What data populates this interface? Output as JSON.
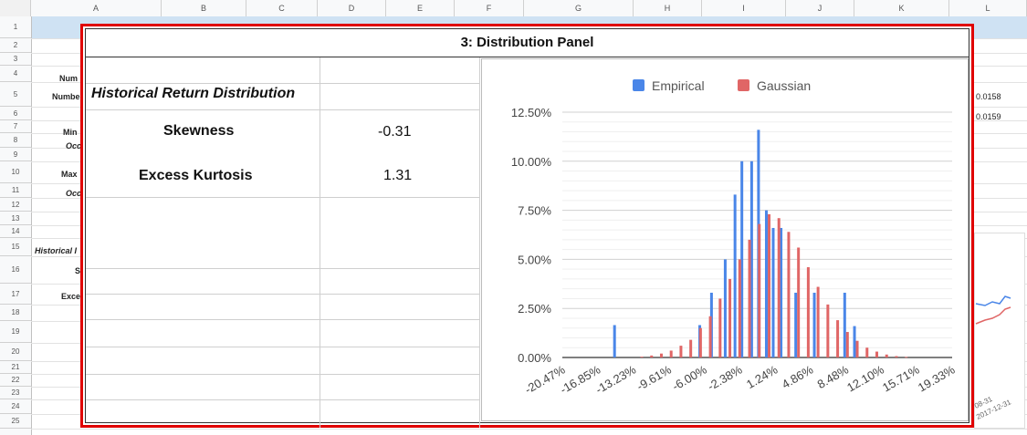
{
  "columns": [
    "A",
    "B",
    "C",
    "D",
    "E",
    "F",
    "G",
    "H",
    "I",
    "J",
    "K",
    "L"
  ],
  "rows": [
    "1",
    "2",
    "3",
    "4",
    "5",
    "6",
    "7",
    "8",
    "9",
    "10",
    "11",
    "12",
    "13",
    "14",
    "15",
    "16",
    "17",
    "18",
    "19",
    "20",
    "21",
    "22",
    "23",
    "24",
    "25"
  ],
  "background": {
    "left_labels": [
      "Num",
      "Numbe",
      "Min",
      "Occ",
      "Max",
      "Occ",
      "Historical I",
      "S",
      "Exce"
    ],
    "right_values": [
      "0.0158",
      "0.0159"
    ],
    "right_dates": [
      "08-31",
      "2017-12-31"
    ]
  },
  "panel": {
    "title": "3: Distribution Panel",
    "section_title": "Historical Return Distribution",
    "stats": [
      {
        "label": "Skewness",
        "value": "-0.31"
      },
      {
        "label": "Excess Kurtosis",
        "value": "1.31"
      }
    ]
  },
  "chart_data": {
    "type": "bar",
    "legend_position": "top",
    "grid": true,
    "colors": {
      "Empirical": "#4a86e8",
      "Gaussian": "#e06666"
    },
    "y_ticks": [
      "0.00%",
      "2.50%",
      "5.00%",
      "7.50%",
      "10.00%",
      "12.50%"
    ],
    "ylim": [
      0,
      0.125
    ],
    "x_tick_labels": [
      "-20.47%",
      "-16.85%",
      "-13.23%",
      "-9.61%",
      "-6.00%",
      "-2.38%",
      "1.24%",
      "4.86%",
      "8.48%",
      "12.10%",
      "15.71%",
      "19.33%"
    ],
    "xlim": [
      -0.2047,
      0.1933
    ],
    "series": [
      {
        "name": "Empirical",
        "points": [
          {
            "x": -0.15,
            "y": 0.0165
          },
          {
            "x": -0.063,
            "y": 0.0165
          },
          {
            "x": -0.051,
            "y": 0.033
          },
          {
            "x": -0.037,
            "y": 0.05
          },
          {
            "x": -0.027,
            "y": 0.083
          },
          {
            "x": -0.02,
            "y": 0.1
          },
          {
            "x": -0.01,
            "y": 0.1
          },
          {
            "x": -0.003,
            "y": 0.116
          },
          {
            "x": 0.005,
            "y": 0.075
          },
          {
            "x": 0.012,
            "y": 0.066
          },
          {
            "x": 0.02,
            "y": 0.066
          },
          {
            "x": 0.035,
            "y": 0.033
          },
          {
            "x": 0.054,
            "y": 0.033
          },
          {
            "x": 0.085,
            "y": 0.033
          },
          {
            "x": 0.095,
            "y": 0.016
          }
        ]
      },
      {
        "name": "Gaussian",
        "points": [
          {
            "x": -0.125,
            "y": 0.0004
          },
          {
            "x": -0.115,
            "y": 0.001
          },
          {
            "x": -0.105,
            "y": 0.002
          },
          {
            "x": -0.095,
            "y": 0.0035
          },
          {
            "x": -0.085,
            "y": 0.006
          },
          {
            "x": -0.075,
            "y": 0.009
          },
          {
            "x": -0.065,
            "y": 0.015
          },
          {
            "x": -0.055,
            "y": 0.021
          },
          {
            "x": -0.045,
            "y": 0.03
          },
          {
            "x": -0.035,
            "y": 0.04
          },
          {
            "x": -0.025,
            "y": 0.05
          },
          {
            "x": -0.015,
            "y": 0.06
          },
          {
            "x": -0.005,
            "y": 0.068
          },
          {
            "x": 0.005,
            "y": 0.073
          },
          {
            "x": 0.015,
            "y": 0.071
          },
          {
            "x": 0.025,
            "y": 0.064
          },
          {
            "x": 0.035,
            "y": 0.056
          },
          {
            "x": 0.045,
            "y": 0.046
          },
          {
            "x": 0.055,
            "y": 0.036
          },
          {
            "x": 0.065,
            "y": 0.027
          },
          {
            "x": 0.075,
            "y": 0.019
          },
          {
            "x": 0.085,
            "y": 0.013
          },
          {
            "x": 0.095,
            "y": 0.0085
          },
          {
            "x": 0.105,
            "y": 0.005
          },
          {
            "x": 0.115,
            "y": 0.003
          },
          {
            "x": 0.125,
            "y": 0.0015
          },
          {
            "x": 0.135,
            "y": 0.0007
          },
          {
            "x": 0.145,
            "y": 0.0003
          }
        ]
      }
    ]
  }
}
